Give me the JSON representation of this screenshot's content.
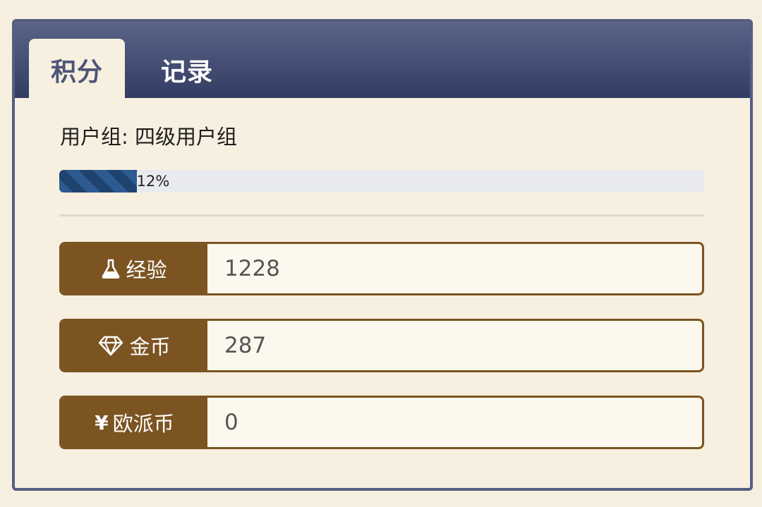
{
  "tabs": [
    {
      "label": "积分",
      "active": true
    },
    {
      "label": "记录",
      "active": false
    }
  ],
  "user_group": {
    "text": "用户组: 四级用户组"
  },
  "progress": {
    "percent": 12,
    "label": "12%"
  },
  "stats": [
    {
      "label": "经验",
      "icon": "flask-icon",
      "value": "1228"
    },
    {
      "label": "金币",
      "icon": "diamond-icon",
      "value": "287"
    },
    {
      "label": "欧派币",
      "icon": "yen-icon",
      "icon_glyph": "¥",
      "value": "0"
    }
  ],
  "colors": {
    "header": "#404a70",
    "accent_brown": "#7b5422",
    "background": "#f7efdf",
    "progress_fill": "#23497a"
  }
}
